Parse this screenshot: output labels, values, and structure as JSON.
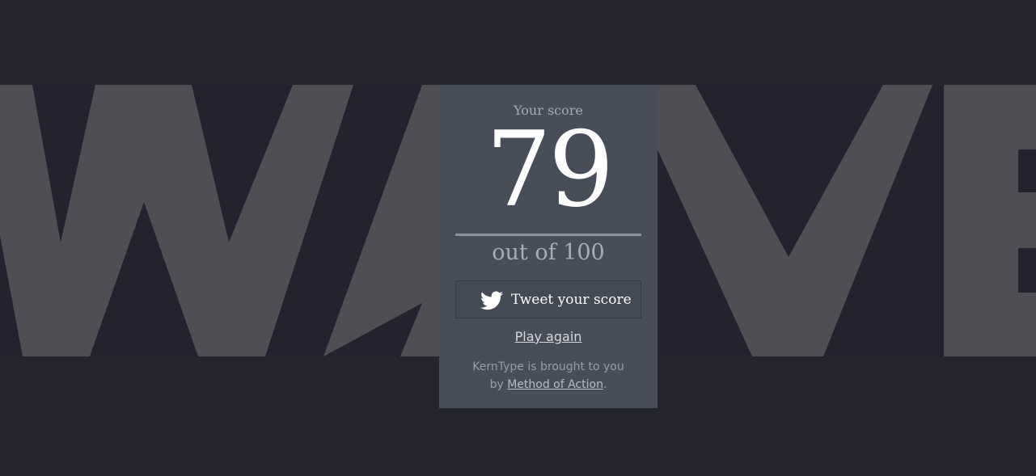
{
  "game": {
    "word": "WAVE",
    "word_color": "#4f4e54",
    "background_color": "#252530",
    "card_color": "#474e5a"
  },
  "score": {
    "label": "Your score",
    "value": "79",
    "out_of": "out of 100"
  },
  "actions": {
    "tweet_label": "Tweet your score",
    "tweet_icon": "twitter-bird-icon",
    "play_again_label": "Play again"
  },
  "credits": {
    "line1": "KernType is brought to you",
    "by_prefix": "by",
    "link_text": "Method of Action",
    "suffix": "."
  }
}
